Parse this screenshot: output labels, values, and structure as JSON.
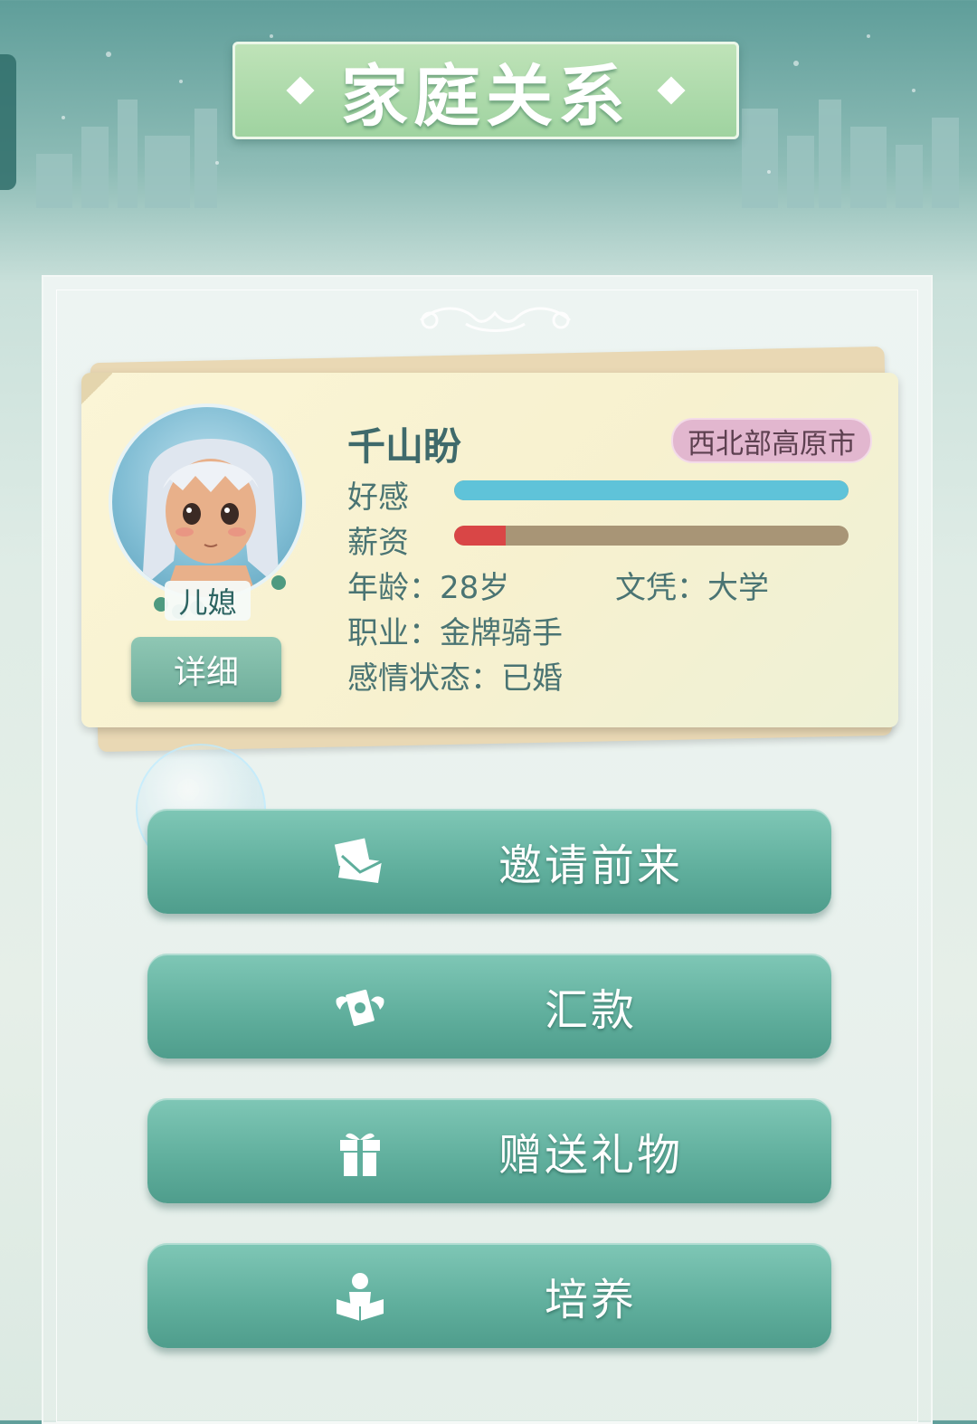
{
  "header": {
    "title": "家庭关系"
  },
  "profile": {
    "name": "千山盼",
    "location": "西北部高原市",
    "role": "儿媳",
    "detail_button": "详细",
    "affection_label": "好感",
    "affection_level": 1.0,
    "salary_label": "薪资",
    "salary_level": 0.13,
    "age_text": "年龄：28岁",
    "education_text": "文凭：大学",
    "job_text": "职业：金牌骑手",
    "relationship_text": "感情状态：已婚"
  },
  "actions": [
    {
      "label": "邀请前来",
      "icon": "envelope-icon"
    },
    {
      "label": "汇款",
      "icon": "money-wings-icon"
    },
    {
      "label": "赠送礼物",
      "icon": "gift-icon"
    },
    {
      "label": "培养",
      "icon": "reading-person-icon"
    }
  ],
  "colors": {
    "affection": "#5fc3d9",
    "salary": "#d94646",
    "button": "#5fae9c"
  }
}
